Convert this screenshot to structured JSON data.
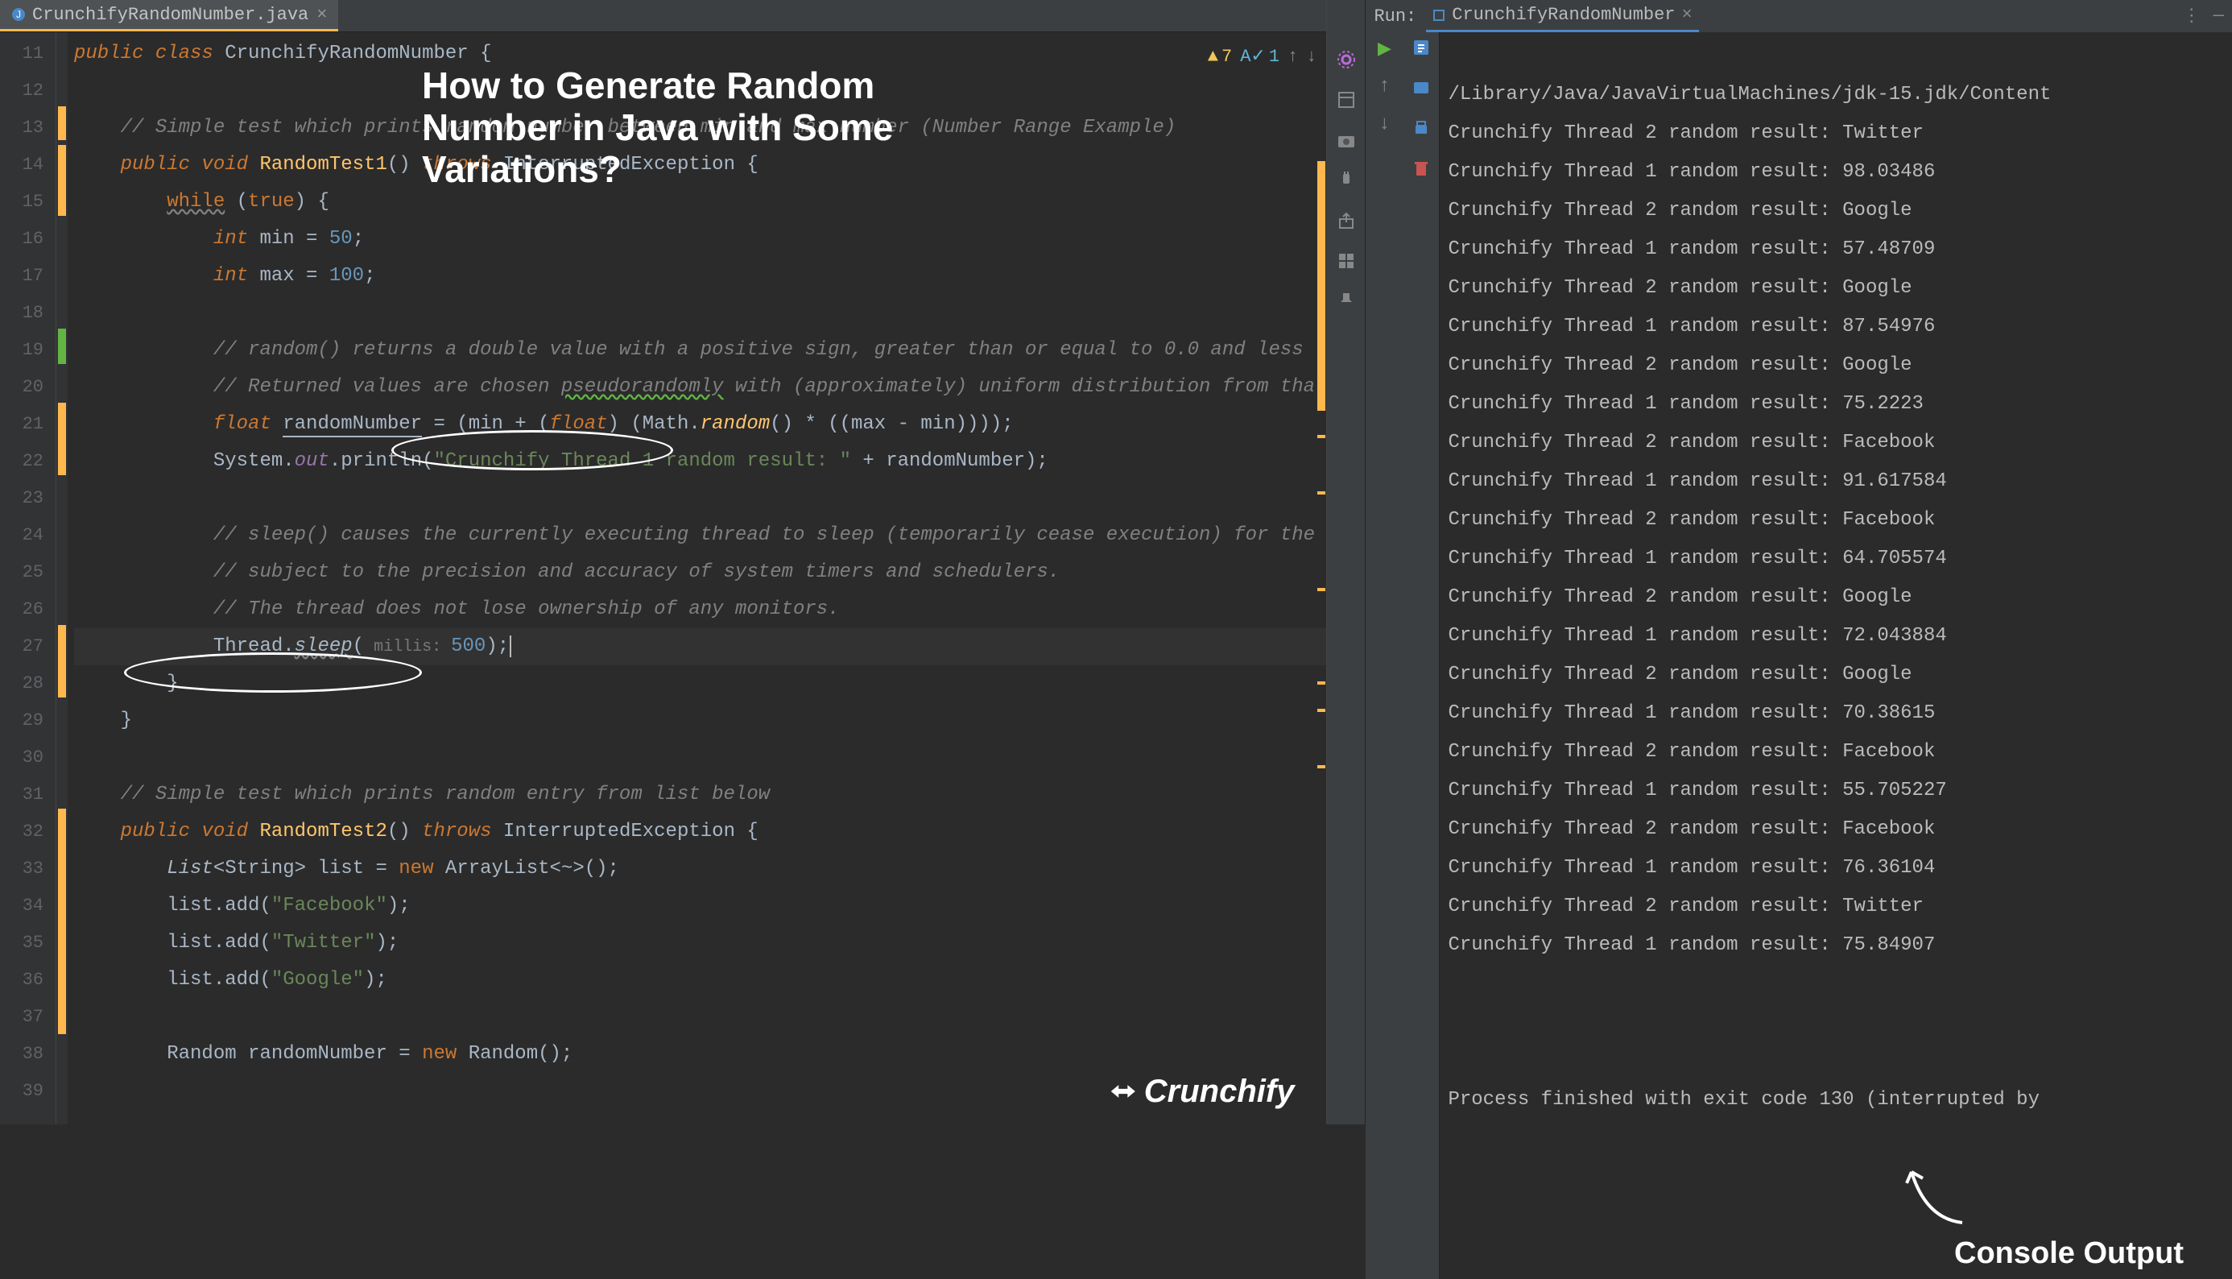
{
  "tabs": {
    "editor": "CrunchifyRandomNumber.java"
  },
  "overlay": "How to Generate Random Number in Java with Some Variations?",
  "header_counts": {
    "warnings": "7",
    "typos": "1"
  },
  "lines": {
    "start": 11,
    "end": 39
  },
  "code": {
    "l11": "public class CrunchifyRandomNumber {",
    "l13_comment": "// Simple test which prints random number between min and max number (Number Range Example)",
    "l14_a": "public void ",
    "l14_b": "RandomTest1",
    "l14_c": "() ",
    "l14_d": "throws",
    "l14_e": " InterruptedException {",
    "l15_a": "while",
    "l15_b": " (",
    "l15_c": "true",
    "l15_d": ") {",
    "l16_a": "int",
    "l16_b": " min = ",
    "l16_c": "50",
    "l16_d": ";",
    "l17_a": "int",
    "l17_b": " max = ",
    "l17_c": "100",
    "l17_d": ";",
    "l20_comment": "// random() returns a double value with a positive sign, greater than or equal to 0.0 and less t",
    "l21_comment_a": "// Returned values are chosen ",
    "l21_comment_b": "pseudorandomly",
    "l21_comment_c": " with (approximately) uniform distribution from tha",
    "l22_a": "float",
    "l22_b": " ",
    "l22_var": "randomNumber",
    "l22_c": " = (min + (",
    "l22_d": "float",
    "l22_e": ") (Math.",
    "l22_f": "random",
    "l22_g": "() * ((max - min))));",
    "l23_a": "System.",
    "l23_b": "out",
    "l23_c": ".println(",
    "l23_d": "\"Crunchify Thread 1 random result: \"",
    "l23_e": " + randomNumber);",
    "l25_comment": "// sleep() causes the currently executing thread to sleep (temporarily cease execution) for the",
    "l26_comment": "// subject to the precision and accuracy of system timers and schedulers.",
    "l27_comment": "// The thread does not lose ownership of any monitors.",
    "l28_a": "Thread.",
    "l28_b": "sleep",
    "l28_c": "(",
    "l28_hint": " millis: ",
    "l28_d": "500",
    "l28_e": ");",
    "l29": "}",
    "l30": "}",
    "l32_comment": "// Simple test which prints random entry from list below",
    "l33_a": "public void ",
    "l33_b": "RandomTest2",
    "l33_c": "() ",
    "l33_d": "throws",
    "l33_e": " InterruptedException {",
    "l34_a": "List",
    "l34_b": "<String> list = ",
    "l34_c": "new",
    "l34_d": " ArrayList<~>();",
    "l35_a": "list.add(",
    "l35_b": "\"Facebook\"",
    "l35_c": ");",
    "l36_a": "list.add(",
    "l36_b": "\"Twitter\"",
    "l36_c": ");",
    "l37_a": "list.add(",
    "l37_b": "\"Google\"",
    "l37_c": ");",
    "l39_a": "Random randomNumber = ",
    "l39_b": "new",
    "l39_c": " Random();"
  },
  "run": {
    "label": "Run:",
    "tab": "CrunchifyRandomNumber",
    "cmd": "/Library/Java/JavaVirtualMachines/jdk-15.jdk/Content",
    "output": [
      "Crunchify Thread 2 random result: Twitter",
      "Crunchify Thread 1 random result: 98.03486",
      "Crunchify Thread 2 random result: Google",
      "Crunchify Thread 1 random result: 57.48709",
      "Crunchify Thread 2 random result: Google",
      "Crunchify Thread 1 random result: 87.54976",
      "Crunchify Thread 2 random result: Google",
      "Crunchify Thread 1 random result: 75.2223",
      "Crunchify Thread 2 random result: Facebook",
      "Crunchify Thread 1 random result: 91.617584",
      "Crunchify Thread 2 random result: Facebook",
      "Crunchify Thread 1 random result: 64.705574",
      "Crunchify Thread 2 random result: Google",
      "Crunchify Thread 1 random result: 72.043884",
      "Crunchify Thread 2 random result: Google",
      "Crunchify Thread 1 random result: 70.38615",
      "Crunchify Thread 2 random result: Facebook",
      "Crunchify Thread 1 random result: 55.705227",
      "Crunchify Thread 2 random result: Facebook",
      "Crunchify Thread 1 random result: 76.36104",
      "Crunchify Thread 2 random result: Twitter",
      "Crunchify Thread 1 random result: 75.84907"
    ],
    "exit": "Process finished with exit code 130 (interrupted by "
  },
  "labels": {
    "logo": "Crunchify",
    "console": "Console Output"
  }
}
